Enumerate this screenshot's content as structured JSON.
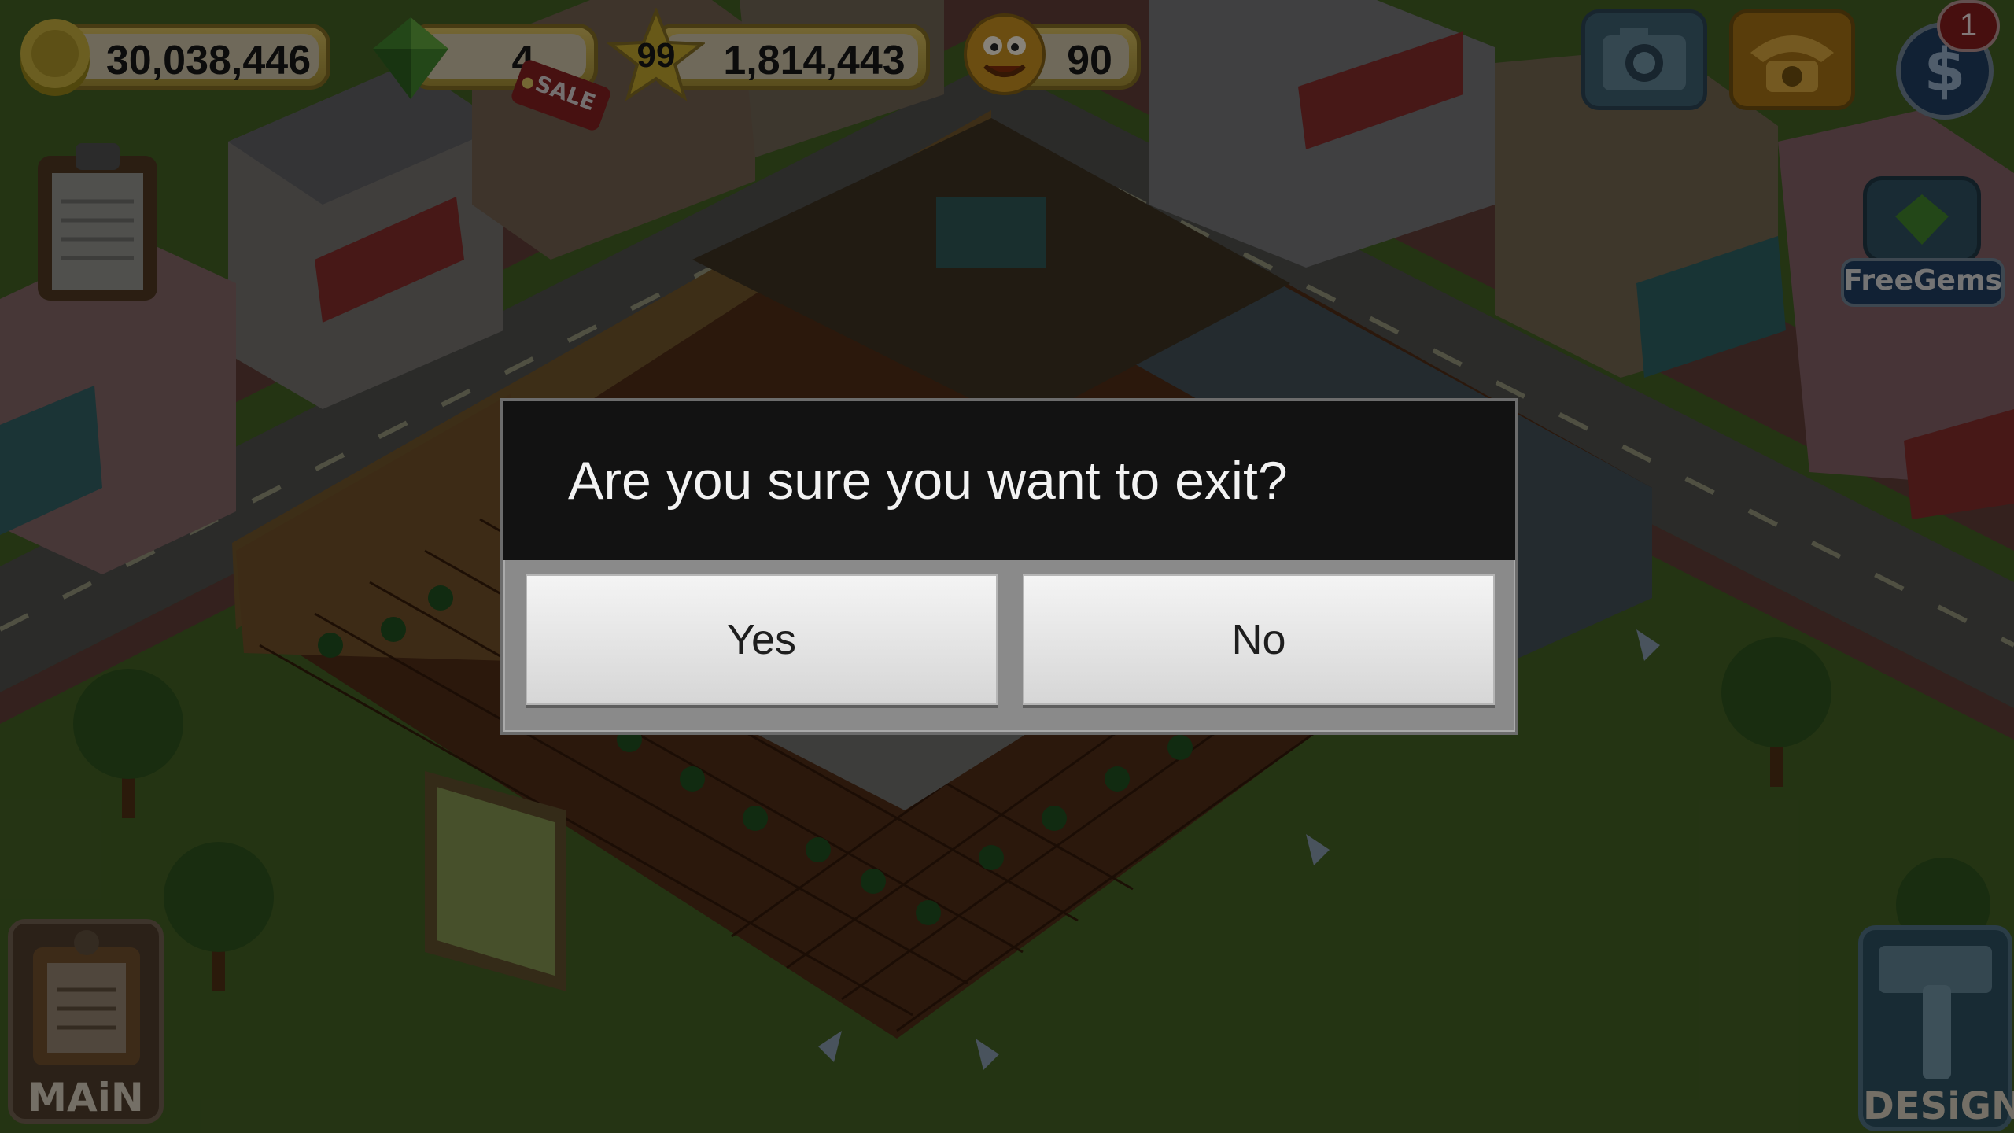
{
  "hud": {
    "coins": "30,038,446",
    "gems": "4",
    "sale_tag": "SALE",
    "level": "99",
    "experience": "1,814,443",
    "happiness": "90",
    "notification_count": "1"
  },
  "side_buttons": {
    "free_gems_label": "FreeGems",
    "main_label": "MAiN",
    "design_label": "DESiGN"
  },
  "dialog": {
    "title": "Are you sure you want to exit?",
    "yes_label": "Yes",
    "no_label": "No"
  },
  "icons": {
    "coins": "coin-stack-icon",
    "gems": "gem-icon",
    "level": "star-icon",
    "happiness": "smiley-icon",
    "camera": "camera-icon",
    "phone": "telephone-icon",
    "currency": "dollar-icon",
    "clipboard": "clipboard-icon",
    "hammer": "hammer-icon"
  },
  "colors": {
    "grass": "#3f5a22",
    "road": "#4a4a48",
    "floor_tiles": "#5a2a12",
    "dialog_header": "#121212",
    "dialog_body": "#8a8a8a",
    "button_face": "#e6e6e6"
  }
}
